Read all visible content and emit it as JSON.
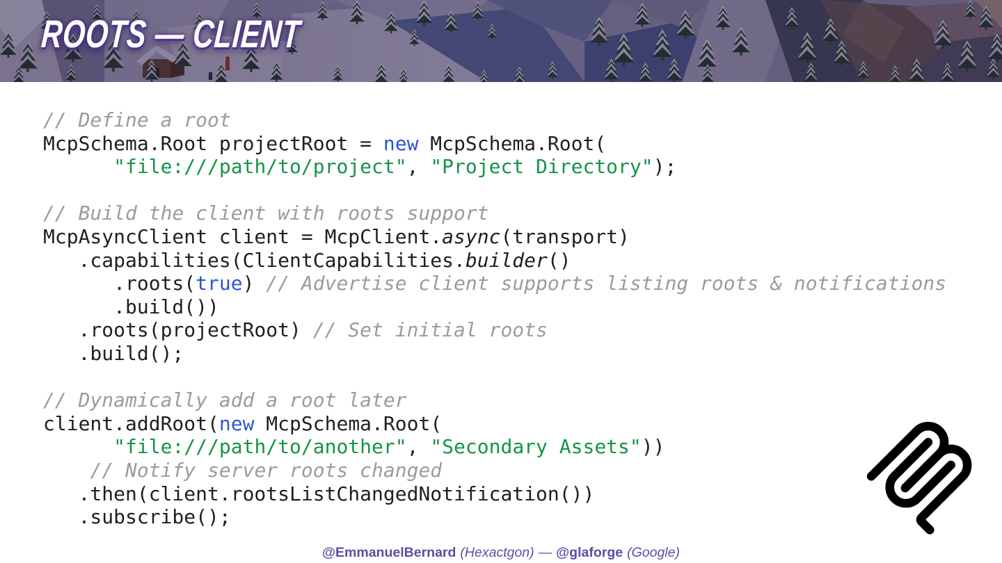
{
  "slide": {
    "title": "Roots — Client",
    "footer": {
      "author1_handle": "@EmmanuelBernard",
      "author1_org": "(Hexactgon)",
      "separator": "—",
      "author2_handle": "@glaforge",
      "author2_org": "(Google)"
    }
  },
  "icons": {
    "logo": "mcp-logo"
  },
  "colors": {
    "code_text": "#1f1f1f",
    "code_comment": "#9b9b9b",
    "code_keyword": "#2b56d2",
    "code_string": "#159447",
    "footer_text": "#5a4fa2",
    "title_text": "#ffffff",
    "title_outline": "#4a3590",
    "logo": "#000000"
  },
  "code": {
    "lines": [
      [
        {
          "t": "c",
          "s": "// Define a root"
        }
      ],
      [
        {
          "t": "p",
          "s": "McpSchema.Root projectRoot = "
        },
        {
          "t": "k",
          "s": "new"
        },
        {
          "t": "p",
          "s": " McpSchema.Root("
        }
      ],
      [
        {
          "t": "p",
          "s": "      "
        },
        {
          "t": "s",
          "s": "\"file:///path/to/project\""
        },
        {
          "t": "p",
          "s": ", "
        },
        {
          "t": "s",
          "s": "\"Project Directory\""
        },
        {
          "t": "p",
          "s": ");"
        }
      ],
      [],
      [
        {
          "t": "c",
          "s": "// Build the client with roots support"
        }
      ],
      [
        {
          "t": "p",
          "s": "McpAsyncClient client = McpClient."
        },
        {
          "t": "i",
          "s": "async"
        },
        {
          "t": "p",
          "s": "(transport)"
        }
      ],
      [
        {
          "t": "p",
          "s": "   .capabilities(ClientCapabilities."
        },
        {
          "t": "i",
          "s": "builder"
        },
        {
          "t": "p",
          "s": "()"
        }
      ],
      [
        {
          "t": "p",
          "s": "      .roots("
        },
        {
          "t": "k",
          "s": "true"
        },
        {
          "t": "p",
          "s": ") "
        },
        {
          "t": "c",
          "s": "// Advertise client supports listing roots & notifications"
        }
      ],
      [
        {
          "t": "p",
          "s": "      .build())"
        }
      ],
      [
        {
          "t": "p",
          "s": "   .roots(projectRoot) "
        },
        {
          "t": "c",
          "s": "// Set initial roots"
        }
      ],
      [
        {
          "t": "p",
          "s": "   .build();"
        }
      ],
      [],
      [
        {
          "t": "c",
          "s": "// Dynamically add a root later"
        }
      ],
      [
        {
          "t": "p",
          "s": "client.addRoot("
        },
        {
          "t": "k",
          "s": "new"
        },
        {
          "t": "p",
          "s": " McpSchema.Root("
        }
      ],
      [
        {
          "t": "p",
          "s": "      "
        },
        {
          "t": "s",
          "s": "\"file:///path/to/another\""
        },
        {
          "t": "p",
          "s": ", "
        },
        {
          "t": "s",
          "s": "\"Secondary Assets\""
        },
        {
          "t": "p",
          "s": "))"
        }
      ],
      [
        {
          "t": "p",
          "s": "    "
        },
        {
          "t": "c",
          "s": "// Notify server roots changed"
        }
      ],
      [
        {
          "t": "p",
          "s": "   .then(client.rootsListChangedNotification())"
        }
      ],
      [
        {
          "t": "p",
          "s": "   .subscribe();"
        }
      ]
    ]
  }
}
